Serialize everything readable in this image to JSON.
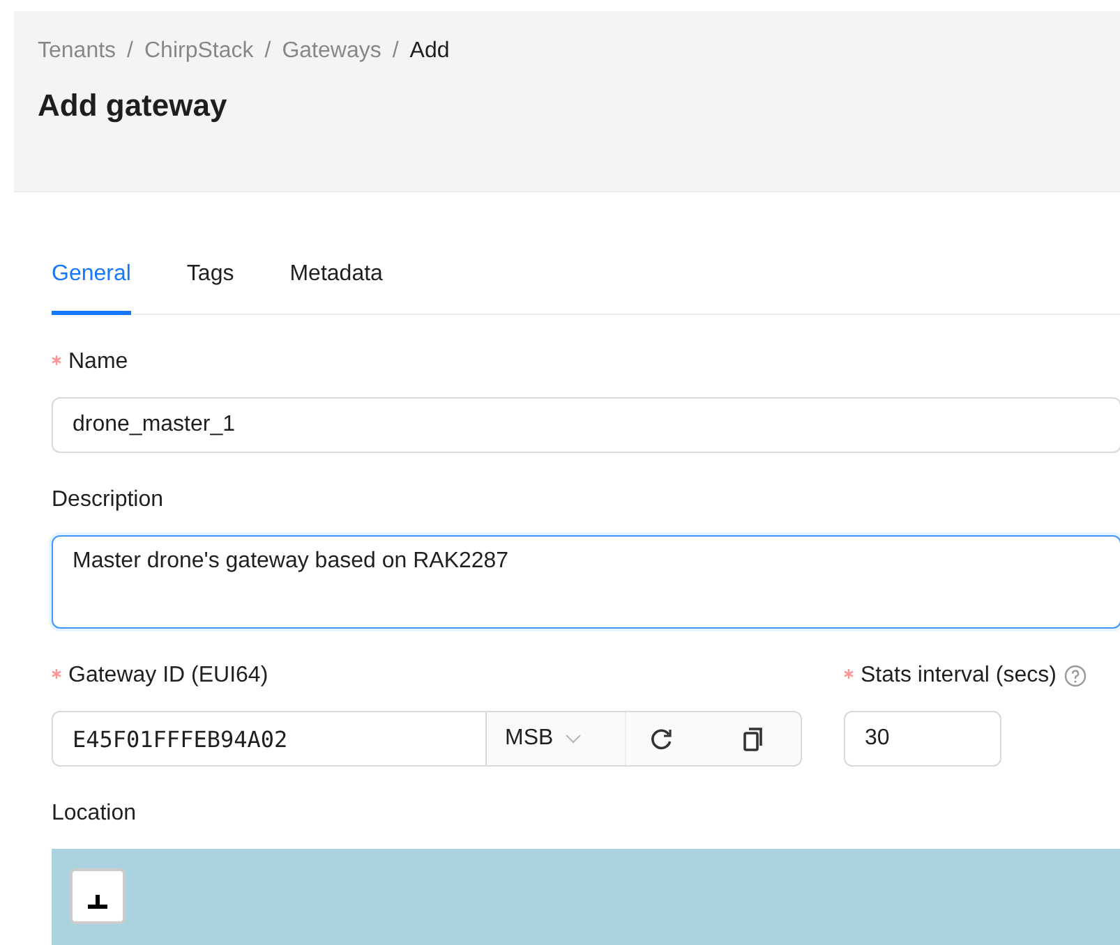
{
  "breadcrumb": [
    {
      "kind": "link",
      "label": "Tenants"
    },
    {
      "kind": "separator",
      "label": "/"
    },
    {
      "kind": "link",
      "label": "ChirpStack"
    },
    {
      "kind": "separator",
      "label": "/"
    },
    {
      "kind": "link",
      "label": "Gateways"
    },
    {
      "kind": "separator",
      "label": "/"
    },
    {
      "kind": "current",
      "label": "Add"
    }
  ],
  "title": "Add gateway",
  "tabs": [
    {
      "label": "General",
      "selected": true
    },
    {
      "label": "Tags",
      "selected": false
    },
    {
      "label": "Metadata",
      "selected": false
    }
  ],
  "name_field": {
    "label": "Name",
    "required": true,
    "value": "drone_master_1",
    "focused": false
  },
  "description_field": {
    "label": "Description",
    "value": "Master drone's gateway based on RAK2287",
    "focused": true
  },
  "gateway_id_field": {
    "label": "Gateway ID (EUI64)",
    "required": true,
    "value": "E45F01FFFEB94A02",
    "byte_order": "MSB"
  },
  "stats_interval_field": {
    "label": "Stats interval (secs)",
    "required": true,
    "help": true,
    "value": "30"
  },
  "location": {
    "label": "Location"
  }
}
